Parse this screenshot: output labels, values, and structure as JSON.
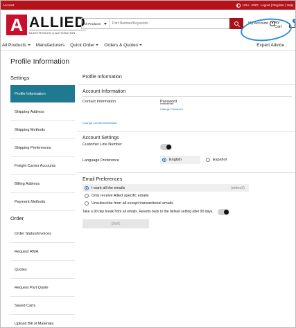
{
  "topbar": {
    "left": "Account",
    "locale": "USA - ENG",
    "links": "Logout | Register | Help"
  },
  "logo": {
    "letter": "A",
    "word": "ALLIED",
    "sub": "ELECTRONICS & AUTOMATION"
  },
  "search": {
    "category": "All Products",
    "placeholder": "Part Number/Keywords"
  },
  "header": {
    "account": "My Account",
    "cart": "My Cart",
    "cart_count": "0"
  },
  "nav": {
    "all_products": "All Products",
    "manufacturers": "Manufacturers",
    "quick_order": "Quick Order",
    "orders_quotes": "Orders & Quotes",
    "expert": "Expert Advice"
  },
  "page_title": "Profile Information",
  "sidebar": {
    "settings_label": "Settings",
    "settings": [
      "Profile Information",
      "Shipping Address",
      "Shipping Methods",
      "Shipping Preferences",
      "Freight Carrier Accounts",
      "Billing Address",
      "Payment Methods"
    ],
    "order_label": "Order",
    "order": [
      "Order Status/Invoices",
      "Request RMA",
      "Quotes",
      "Request Part Quote",
      "Saved Carts",
      "Upload Bill of Materials"
    ]
  },
  "main": {
    "heading": "Profile Information",
    "account_info": "Account Information",
    "contact_info": "Contact Information",
    "password_label": "Password",
    "password_value": "**********",
    "change_password": "Change Password",
    "change_contact": "Change Contact Information",
    "account_settings": "Account Settings",
    "customer_line": "Customer Line Number",
    "language_pref": "Language Preference",
    "lang_en": "English",
    "lang_es": "Español",
    "email_prefs": "Email Preferences",
    "email_opt1": "I want all the emails",
    "email_default": "(default)",
    "email_opt2": "Only receive Allied specific emails",
    "email_opt3": "Unsubscribe from all except transactional emails",
    "break_text": "Take a 90 day break from all emails. Reverts back to the default setting after 90 days.",
    "save": "SAVE"
  },
  "colors": {
    "brand_red": "#b5121b",
    "active_teal": "#1f7a91",
    "highlight_blue": "#2a8de0"
  }
}
